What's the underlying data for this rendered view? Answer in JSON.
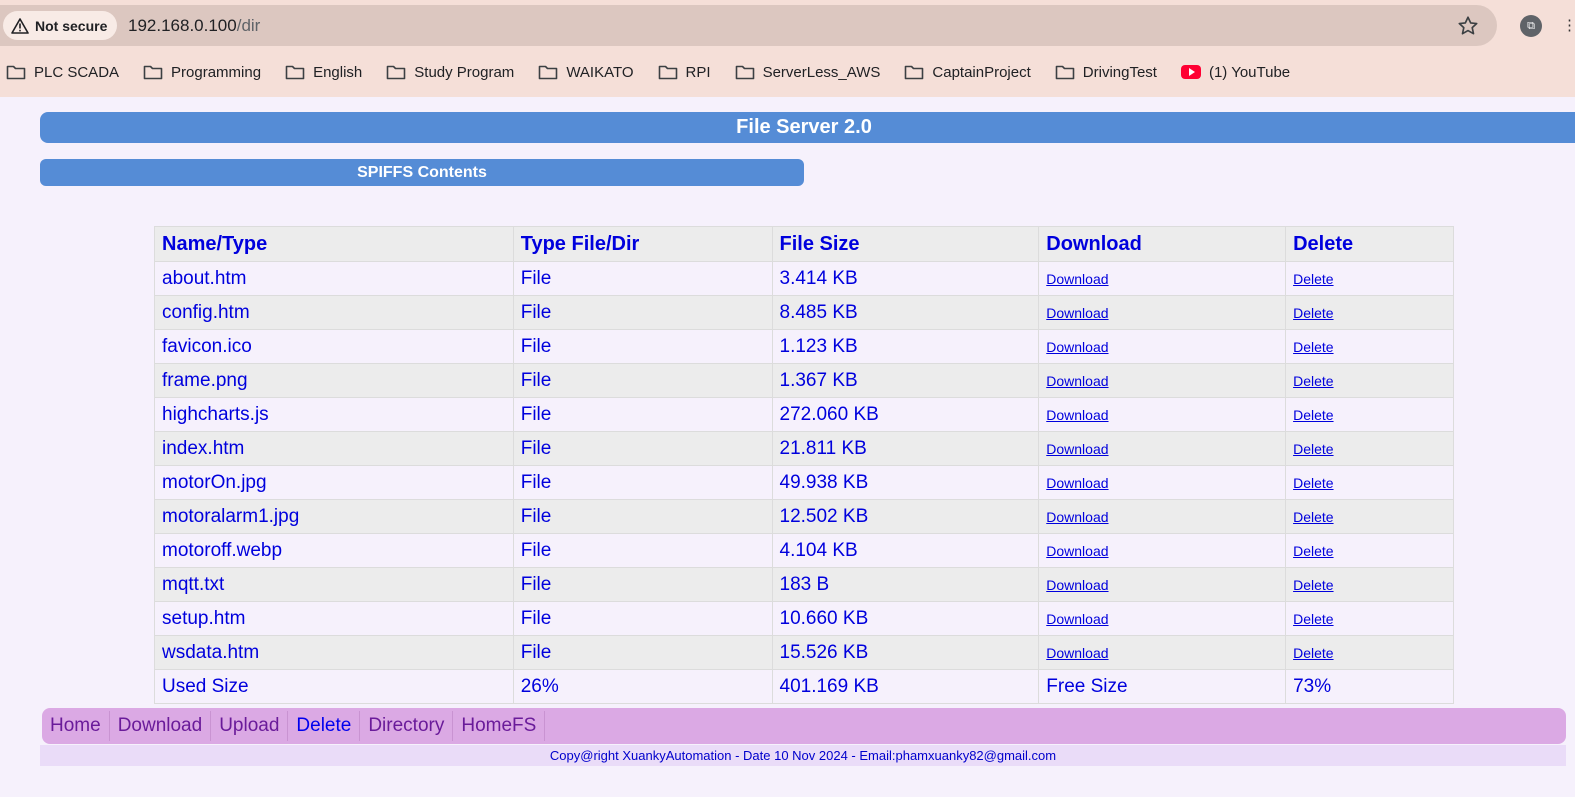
{
  "browser": {
    "security_label": "Not secure",
    "url_host": "192.168.0.100",
    "url_path": "/dir",
    "bookmarks": [
      {
        "label": "PLC SCADA",
        "icon": "folder-icon"
      },
      {
        "label": "Programming",
        "icon": "folder-icon"
      },
      {
        "label": "English",
        "icon": "folder-icon"
      },
      {
        "label": "Study Program",
        "icon": "folder-icon"
      },
      {
        "label": "WAIKATO",
        "icon": "folder-icon"
      },
      {
        "label": "RPI",
        "icon": "folder-icon"
      },
      {
        "label": "ServerLess_AWS",
        "icon": "folder-icon"
      },
      {
        "label": "CaptainProject",
        "icon": "folder-icon"
      },
      {
        "label": "DrivingTest",
        "icon": "folder-icon"
      },
      {
        "label": "(1) YouTube",
        "icon": "youtube-icon"
      }
    ]
  },
  "page": {
    "title": "File Server 2.0",
    "subtitle": "SPIFFS Contents"
  },
  "table": {
    "headers": [
      "Name/Type",
      "Type File/Dir",
      "File Size",
      "Download",
      "Delete"
    ],
    "rows": [
      {
        "name": "about.htm",
        "type": "File",
        "size": "3.414 KB",
        "download": "Download",
        "delete": "Delete"
      },
      {
        "name": "config.htm",
        "type": "File",
        "size": "8.485 KB",
        "download": "Download",
        "delete": "Delete"
      },
      {
        "name": "favicon.ico",
        "type": "File",
        "size": "1.123 KB",
        "download": "Download",
        "delete": "Delete"
      },
      {
        "name": "frame.png",
        "type": "File",
        "size": "1.367 KB",
        "download": "Download",
        "delete": "Delete"
      },
      {
        "name": "highcharts.js",
        "type": "File",
        "size": "272.060 KB",
        "download": "Download",
        "delete": "Delete"
      },
      {
        "name": "index.htm",
        "type": "File",
        "size": "21.811 KB",
        "download": "Download",
        "delete": "Delete"
      },
      {
        "name": "motorOn.jpg",
        "type": "File",
        "size": "49.938 KB",
        "download": "Download",
        "delete": "Delete"
      },
      {
        "name": "motoralarm1.jpg",
        "type": "File",
        "size": "12.502 KB",
        "download": "Download",
        "delete": "Delete"
      },
      {
        "name": "motoroff.webp",
        "type": "File",
        "size": "4.104 KB",
        "download": "Download",
        "delete": "Delete"
      },
      {
        "name": "mqtt.txt",
        "type": "File",
        "size": "183 B",
        "download": "Download",
        "delete": "Delete"
      },
      {
        "name": "setup.htm",
        "type": "File",
        "size": "10.660 KB",
        "download": "Download",
        "delete": "Delete"
      },
      {
        "name": "wsdata.htm",
        "type": "File",
        "size": "15.526 KB",
        "download": "Download",
        "delete": "Delete"
      }
    ],
    "summary": {
      "used_label": "Used Size",
      "used_percent": "26%",
      "total_size": "401.169 KB",
      "free_label": "Free Size",
      "free_percent": "73%"
    }
  },
  "nav": [
    {
      "label": "Home",
      "active": false
    },
    {
      "label": "Download",
      "active": false
    },
    {
      "label": "Upload",
      "active": false
    },
    {
      "label": "Delete",
      "active": true
    },
    {
      "label": "Directory",
      "active": false
    },
    {
      "label": "HomeFS",
      "active": false
    }
  ],
  "footer": "Copy@right XuankyAutomation - Date 10 Nov 2024 - Email:phamxuanky82@gmail.com"
}
